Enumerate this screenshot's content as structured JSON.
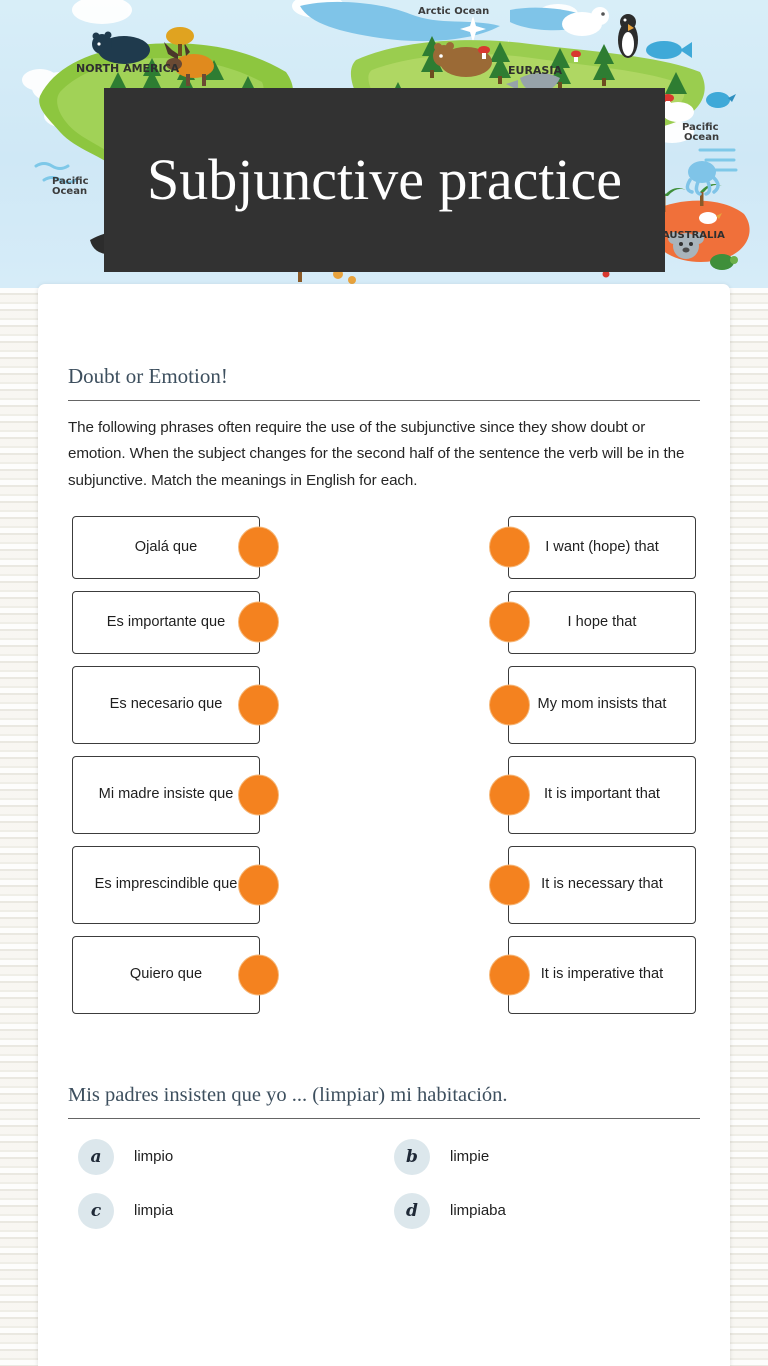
{
  "banner": {
    "map_labels": [
      "NORTH AMERICA",
      "EURASIA",
      "AUSTRALIA"
    ],
    "ocean_labels": [
      "Arctic Ocean",
      "Pacific Ocean",
      "Pacific Ocean"
    ],
    "background_color": "#cfe8f5"
  },
  "title": {
    "text": "Subjunctive practice",
    "plate_color": "#323232",
    "text_color": "#ffffff"
  },
  "section": {
    "heading": "Doubt or Emotion!",
    "instructions": "The following phrases often require the use of the subjunctive since they show doubt or emotion.  When the subject changes for the second half of the sentence the verb will be in the subjunctive.  Match the meanings in English for each."
  },
  "matching": {
    "dot_color": "#f4821f",
    "rows": [
      {
        "left": "Ojalá que",
        "right": "I want (hope) that"
      },
      {
        "left": "Es importante que",
        "right": "I hope that"
      },
      {
        "left": "Es necesario que",
        "right": "My mom insists that"
      },
      {
        "left": "Mi madre insiste que",
        "right": "It is important that"
      },
      {
        "left": "Es imprescindible que",
        "right": "It is necessary that"
      },
      {
        "left": "Quiero que",
        "right": "It is imperative that"
      }
    ]
  },
  "question": {
    "prompt": "Mis padres insisten que yo ...  (limpiar) mi habitación.",
    "options": [
      {
        "letter": "a",
        "text": "limpio"
      },
      {
        "letter": "b",
        "text": "limpie"
      },
      {
        "letter": "c",
        "text": "limpia"
      },
      {
        "letter": "d",
        "text": "limpiaba"
      }
    ]
  }
}
